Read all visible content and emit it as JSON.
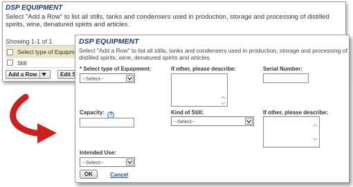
{
  "back": {
    "title": "DSP EQUIPMENT",
    "description": "Select \"Add a Row\" to list all stills, tanks and condensers used in production, storage and processing of distilled spirits, wine, denatured spirits and articles.",
    "showing": "Showing 1-1 of 1",
    "column_header": "Select type of Equipment",
    "rows": [
      "Still"
    ],
    "add_row_label": "Add a Row",
    "edit_label": "Edit Sel"
  },
  "front": {
    "title": "DSP EQUIPMENT",
    "description": "Select \"Add a Row\" to list all stills, tanks and condensers used in production, storage and processing of distilled spirits, wine, denatured spirits and articles.",
    "fields": {
      "equipment_type_label": "* Select type of Equipment:",
      "equipment_type_value": "--Select--",
      "other_describe_label": "If other, please describe:",
      "serial_label": "Serial Number:",
      "capacity_label": "Capacity:",
      "kind_of_still_label": "Kind of Still:",
      "kind_of_still_value": "--Select--",
      "other_describe_label_2": "If other, please describe:",
      "intended_use_label": "Intended Use:",
      "intended_use_value": "--Select--"
    },
    "ok_label": "OK",
    "cancel_label": "Cancel"
  },
  "icons": {
    "help": "help-icon",
    "dropdown": "chevron-down-icon",
    "arrow": "curved-arrow-icon"
  },
  "colors": {
    "title": "#1f3a78",
    "arrow": "#cc1f1f",
    "table_header": "#e9e6c9",
    "link": "#2b4f8f"
  }
}
